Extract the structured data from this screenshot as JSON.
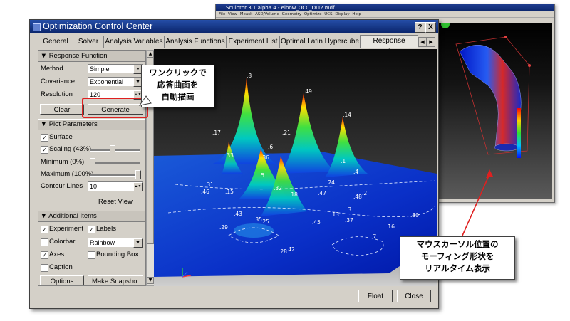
{
  "sculptor": {
    "title": "Sculptor 3.1 alpha 4 - elbow_OCC_OLI2.mdf",
    "menu": [
      "File",
      "View",
      "Meask",
      "ASD/Volume",
      "Geometry",
      "Optimize",
      "UCS",
      "Display",
      "Help"
    ]
  },
  "dialog": {
    "title": "Optimization Control Center",
    "help_btn": "?",
    "close_btn": "X",
    "tabs": [
      "General",
      "Solver",
      "Analysis Variables",
      "Analysis Functions",
      "Experiment List",
      "Optimal Latin Hypercube",
      "Response Surface"
    ],
    "active_tab": "Response Surface",
    "float_label": "Float",
    "close_label": "Close"
  },
  "response_function": {
    "header": "Response Function",
    "method_label": "Method",
    "method_value": "Simple",
    "covariance_label": "Covariance",
    "covariance_value": "Exponential",
    "resolution_label": "Resolution",
    "resolution_value": "120",
    "clear_label": "Clear",
    "generate_label": "Generate"
  },
  "plot_parameters": {
    "header": "Plot Parameters",
    "surface_label": "Surface",
    "scaling_label": "Scaling (43%)",
    "scaling_value": 0.43,
    "minimum_label": "Minimum (0%)",
    "minimum_value": 0,
    "maximum_label": "Maximum (100%)",
    "maximum_value": 1,
    "contour_label": "Contour Lines",
    "contour_value": "10",
    "reset_view_label": "Reset View"
  },
  "additional_items": {
    "header": "Additional Items",
    "experiment_label": "Experiment",
    "labels_label": "Labels",
    "colorbar_label": "Colorbar",
    "colorbar_value": "Rainbow",
    "axes_label": "Axes",
    "bounding_box_label": "Bounding Box",
    "caption_label": "Caption",
    "options_label": "Options",
    "snapshot_label": "Make Snapshot"
  },
  "point_labels": [
    "8",
    "49",
    "14",
    "17",
    "21",
    "6",
    "33",
    "36",
    "1",
    "5",
    "4",
    "32",
    "24",
    "47",
    "31",
    "46",
    "15",
    "18",
    "2",
    "48",
    "3",
    "13",
    "45",
    "37",
    "43",
    "25",
    "35",
    "29",
    "16",
    "30",
    "7",
    "28",
    "42"
  ],
  "callouts": {
    "generate_note": "ワンクリックで\n応答曲面を\n自動描画",
    "morph_note": "マウスカーソル位置の\nモーフィング形状を\nリアルタイム表示"
  },
  "colors": {
    "accent": "#e02020",
    "title_blue": "#0a246a"
  }
}
